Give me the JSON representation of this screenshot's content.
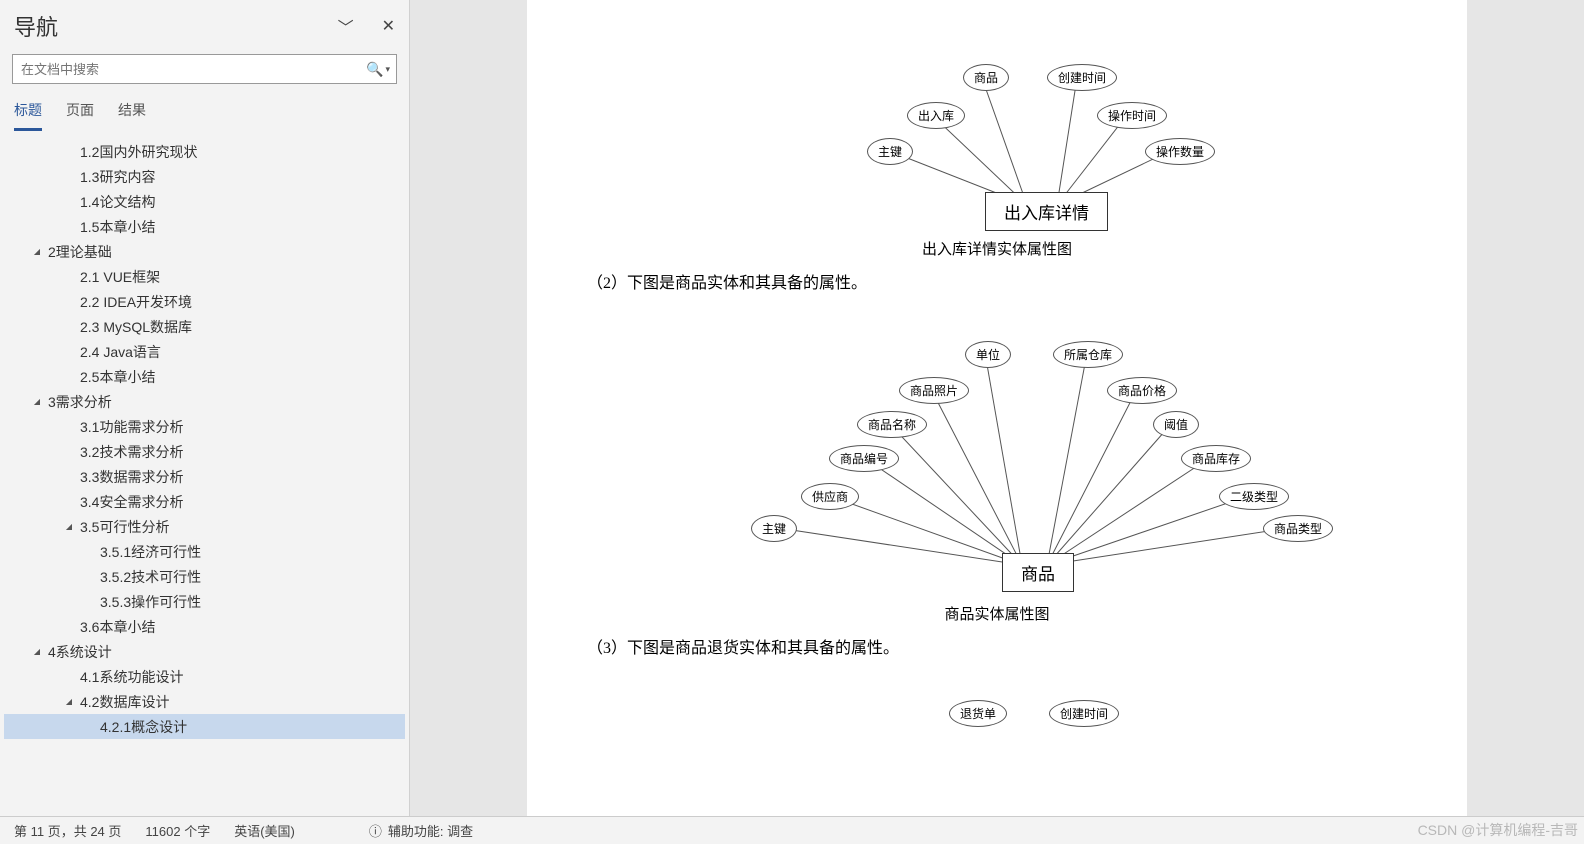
{
  "nav": {
    "title": "导航",
    "search_placeholder": "在文档中搜索",
    "tabs": {
      "headings": "标题",
      "pages": "页面",
      "results": "结果"
    },
    "outline": [
      {
        "label": "1.2国内外研究现状",
        "level": 2,
        "arrow": false
      },
      {
        "label": "1.3研究内容",
        "level": 2,
        "arrow": false
      },
      {
        "label": "1.4论文结构",
        "level": 2,
        "arrow": false
      },
      {
        "label": "1.5本章小结",
        "level": 2,
        "arrow": false
      },
      {
        "label": "2理论基础",
        "level": 1,
        "arrow": true
      },
      {
        "label": "2.1 VUE框架",
        "level": 2,
        "arrow": false
      },
      {
        "label": "2.2 IDEA开发环境",
        "level": 2,
        "arrow": false
      },
      {
        "label": "2.3 MySQL数据库",
        "level": 2,
        "arrow": false
      },
      {
        "label": "2.4 Java语言",
        "level": 2,
        "arrow": false
      },
      {
        "label": "2.5本章小结",
        "level": 2,
        "arrow": false
      },
      {
        "label": "3需求分析",
        "level": 1,
        "arrow": true
      },
      {
        "label": "3.1功能需求分析",
        "level": 2,
        "arrow": false
      },
      {
        "label": "3.2技术需求分析",
        "level": 2,
        "arrow": false
      },
      {
        "label": "3.3数据需求分析",
        "level": 2,
        "arrow": false
      },
      {
        "label": "3.4安全需求分析",
        "level": 2,
        "arrow": false
      },
      {
        "label": "3.5可行性分析",
        "level": 2,
        "arrow": true
      },
      {
        "label": "3.5.1经济可行性",
        "level": 3,
        "arrow": false
      },
      {
        "label": "3.5.2技术可行性",
        "level": 3,
        "arrow": false
      },
      {
        "label": "3.5.3操作可行性",
        "level": 3,
        "arrow": false
      },
      {
        "label": "3.6本章小结",
        "level": 2,
        "arrow": false
      },
      {
        "label": "4系统设计",
        "level": 1,
        "arrow": true
      },
      {
        "label": "4.1系统功能设计",
        "level": 2,
        "arrow": false
      },
      {
        "label": "4.2数据库设计",
        "level": 2,
        "arrow": true
      },
      {
        "label": "4.2.1概念设计",
        "level": 3,
        "arrow": false,
        "selected": true
      }
    ]
  },
  "doc": {
    "diagram1": {
      "center": "出入库详情",
      "attrs": [
        "主键",
        "出入库",
        "商品",
        "创建时间",
        "操作时间",
        "操作数量"
      ],
      "caption": "出入库详情实体属性图"
    },
    "text2": "（2）下图是商品实体和其具备的属性。",
    "diagram2": {
      "center": "商品",
      "attrs": [
        "主键",
        "供应商",
        "商品编号",
        "商品名称",
        "商品照片",
        "单位",
        "所属仓库",
        "商品价格",
        "阈值",
        "商品库存",
        "二级类型",
        "商品类型"
      ],
      "caption": "商品实体属性图"
    },
    "text3": "（3）下图是商品退货实体和其具备的属性。",
    "diagram3_partial": [
      "退货单",
      "创建时间"
    ]
  },
  "status": {
    "page": "第 11 页，共 24 页",
    "words": "11602 个字",
    "lang": "英语(美国)",
    "accessibility": "辅助功能: 调查"
  },
  "watermark": "CSDN @计算机编程-吉哥"
}
